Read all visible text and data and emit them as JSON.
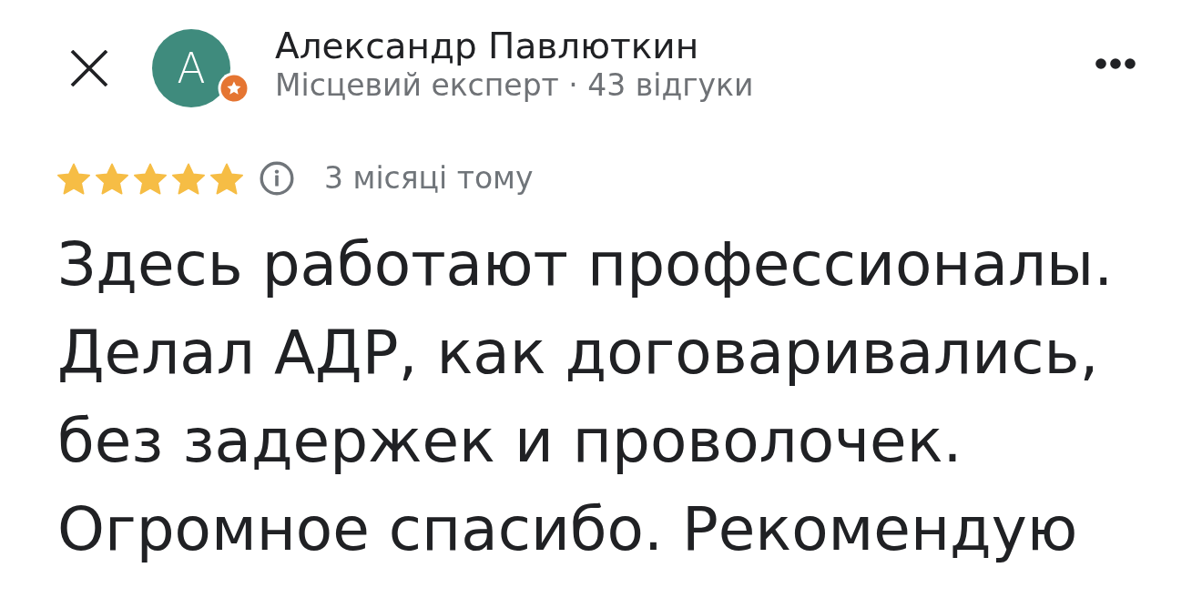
{
  "header": {
    "author": {
      "initial": "А",
      "name": "Александр Павлюткин",
      "subtitle": "Місцевий експерт · 43 відгуки",
      "local_guide_badge": true
    }
  },
  "review": {
    "stars": 5,
    "time": "3 місяці тому",
    "text": "Здесь работают профессионалы. Делал АДР, как договаривались, без задержек и проволочек. Огромное спасибо. Рекомендую"
  }
}
